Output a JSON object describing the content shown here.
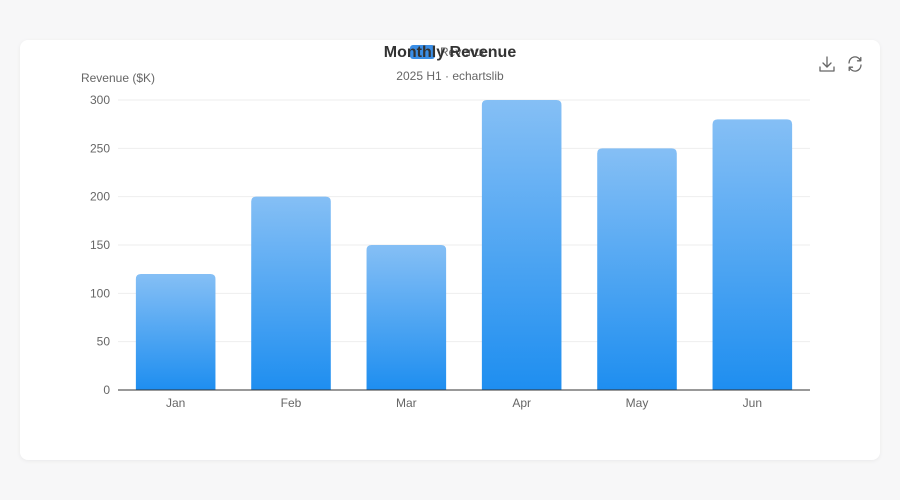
{
  "chart_data": {
    "type": "bar",
    "title": "Monthly Revenue",
    "subtitle": "2025 H1 · echartslib",
    "ylabel": "Revenue ($K)",
    "xlabel": "",
    "categories": [
      "Jan",
      "Feb",
      "Mar",
      "Apr",
      "May",
      "Jun"
    ],
    "series": [
      {
        "name": "Revenue",
        "values": [
          120,
          200,
          150,
          300,
          250,
          280
        ]
      }
    ],
    "ylim": [
      0,
      300
    ],
    "yticks": [
      0,
      50,
      100,
      150,
      200,
      250,
      300
    ],
    "grid": true,
    "legend_position": "top-center",
    "colors": {
      "bar_top": "#85bff5",
      "bar_bottom": "#1e8ef0",
      "legend_swatch": "#3a8ee6",
      "title": "#333333",
      "subtitle": "#666666",
      "axis_label": "#666666",
      "grid": "#eeeeee",
      "axis_line": "#333333"
    }
  },
  "toolbox": {
    "items": [
      {
        "icon": "download-icon",
        "label": "Save as Image"
      },
      {
        "icon": "refresh-icon",
        "label": "Restore"
      }
    ]
  }
}
